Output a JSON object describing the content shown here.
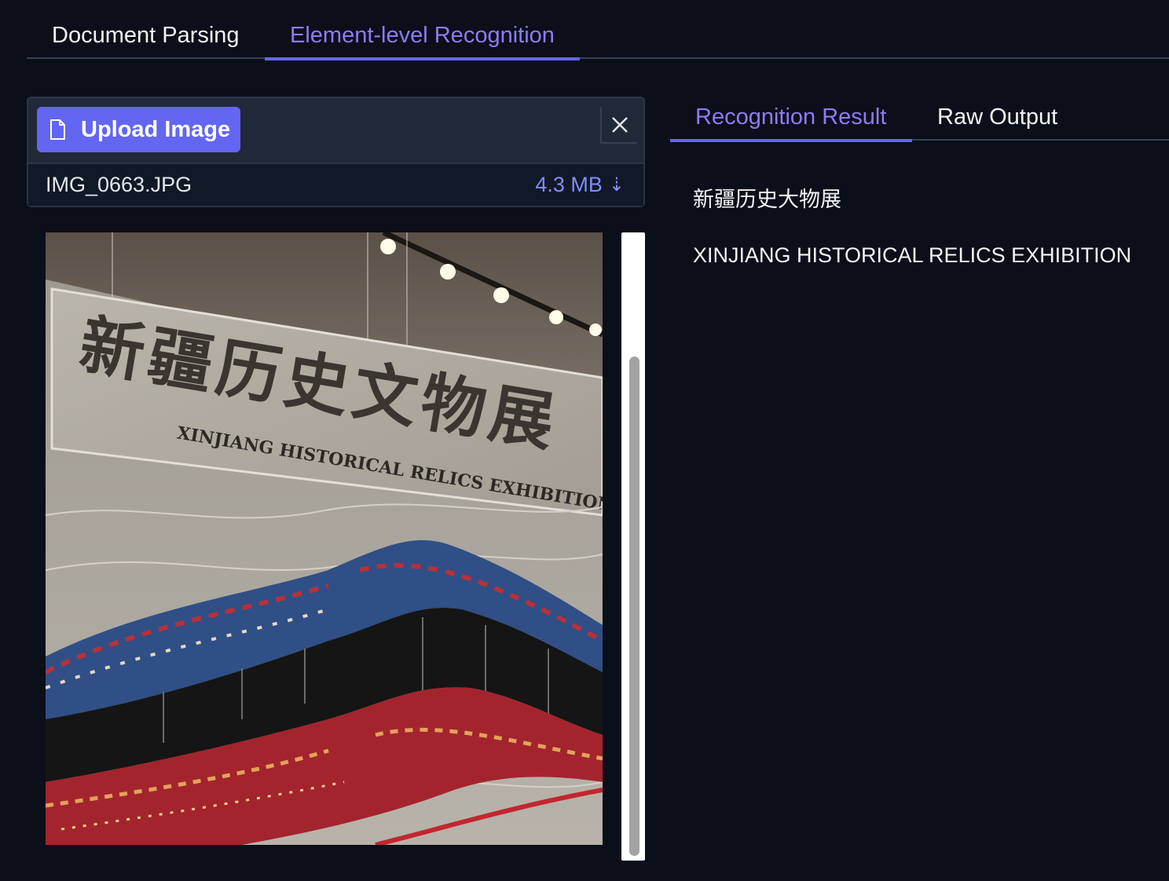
{
  "top_tabs": [
    {
      "label": "Document Parsing",
      "active": false
    },
    {
      "label": "Element-level Recognition",
      "active": true
    }
  ],
  "upload": {
    "button_label": "Upload Image",
    "button_icon": "file-icon",
    "close_icon": "close-icon",
    "file_name": "IMG_0663.JPG",
    "file_size": "4.3 MB",
    "download_icon": "download-icon"
  },
  "preview": {
    "sign_chinese": "新疆历史文物展",
    "sign_english": "XINJIANG HISTORICAL RELICS EXHIBITION"
  },
  "result_tabs": [
    {
      "label": "Recognition Result",
      "active": true
    },
    {
      "label": "Raw Output",
      "active": false
    }
  ],
  "result": {
    "lines": [
      "新疆历史大物展",
      "XINJIANG HISTORICAL RELICS EXHIBITION"
    ]
  },
  "colors": {
    "background": "#0b0f19",
    "accent": "#6366f1",
    "accent_text": "#8b7cf6"
  }
}
